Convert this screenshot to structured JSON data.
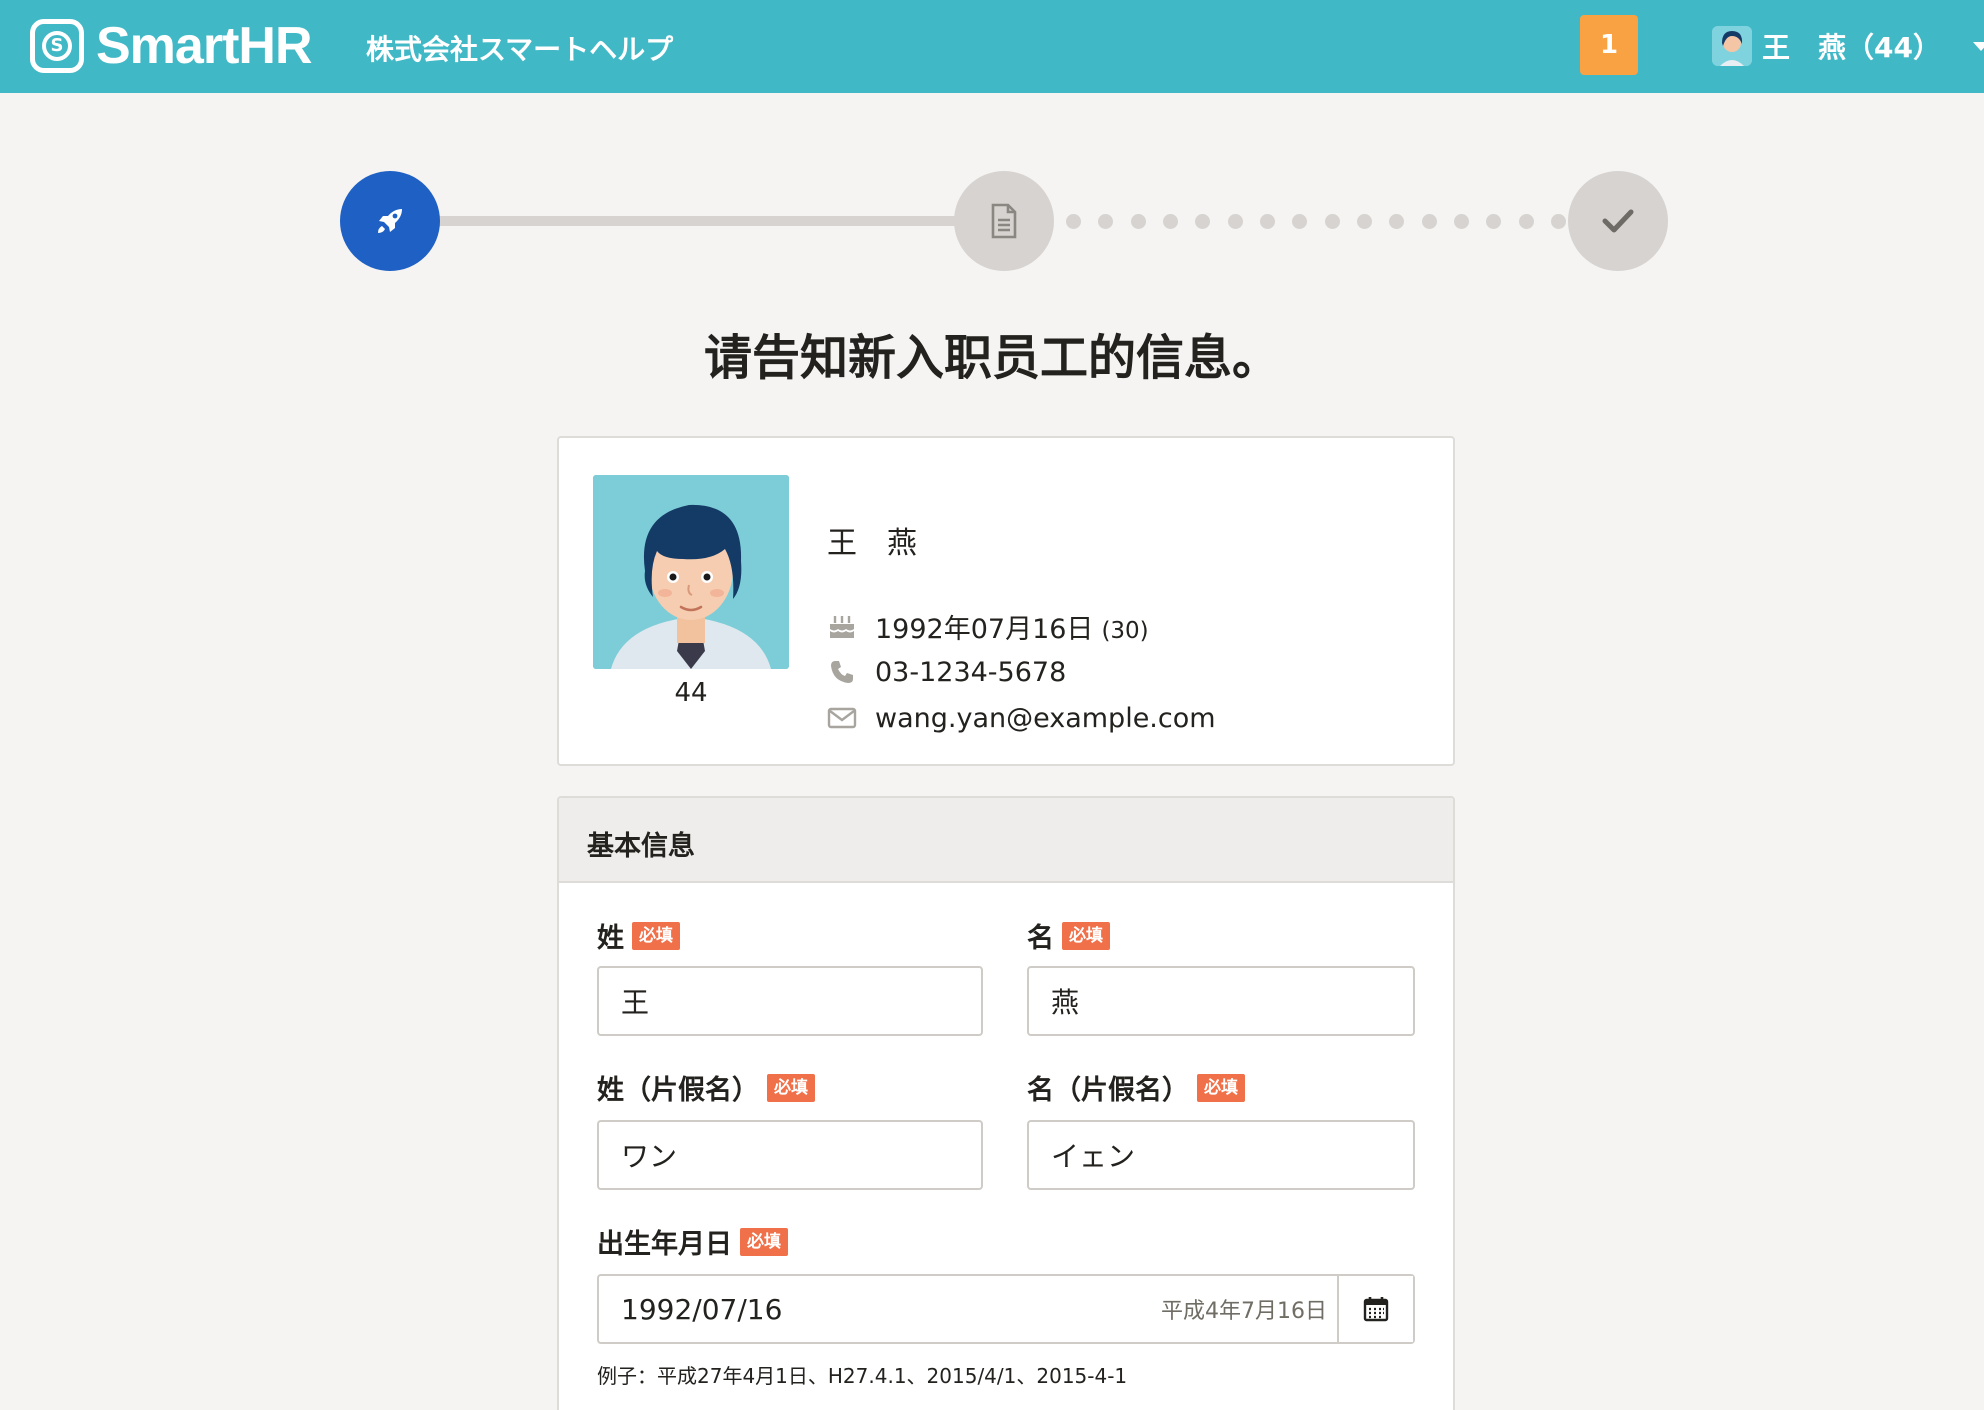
{
  "header": {
    "logo_text": "SmartHR",
    "company_name": "株式会社スマートヘルプ",
    "notification_count": "1",
    "user_label": "王　燕（44）"
  },
  "stepper": {
    "current_step": 1,
    "total_steps": 3
  },
  "page_title": "请告知新入职员工的信息。",
  "profile": {
    "name": "王　燕",
    "photo_caption": "44",
    "birthday": "1992年07月16日",
    "age": "(30)",
    "phone": "03-1234-5678",
    "email": "wang.yan@example.com"
  },
  "basic_info": {
    "title": "基本信息",
    "required_badge": "必填",
    "last_name": {
      "label": "姓",
      "value": "王"
    },
    "first_name": {
      "label": "名",
      "value": "燕"
    },
    "last_name_kana": {
      "label": "姓（片假名）",
      "value": "ワン"
    },
    "first_name_kana": {
      "label": "名（片假名）",
      "value": "イェン"
    },
    "birth_date": {
      "label": "出生年月日",
      "value": "1992/07/16",
      "era_hint": "平成4年7月16日",
      "example": "例子：平成27年4月1日、H27.4.1、2015/4/1、2015-4-1"
    }
  },
  "colors": {
    "header_bg": "#41b8c6",
    "notification_bg": "#f8a243",
    "active_step": "#1f60c4",
    "required_badge": "#f0704a"
  },
  "icons": {
    "step1": "rocket-icon",
    "step2": "document-icon",
    "step3": "check-icon",
    "birthday": "cake-icon",
    "phone": "phone-icon",
    "email": "envelope-icon",
    "calendar": "calendar-icon"
  }
}
